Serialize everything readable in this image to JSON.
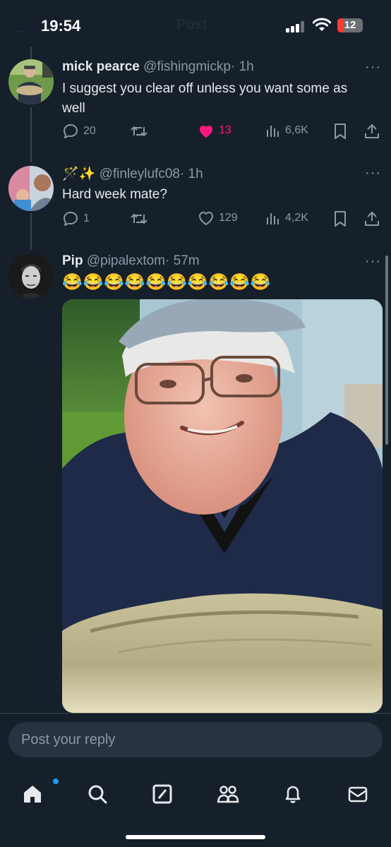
{
  "status_bar": {
    "time": "19:54",
    "battery": "12"
  },
  "header": {
    "back": "←",
    "title": "Post"
  },
  "tweets": [
    {
      "name": "mick pearce",
      "handle": "@fishingmickp",
      "time": "· 1h",
      "text": "I suggest you clear off unless you want some as well",
      "replies": "20",
      "likes": "13",
      "views": "6,6K",
      "liked": true
    },
    {
      "name": "🪄✨",
      "handle": "@finleylufc08",
      "time": "· 1h",
      "text": "Hard week mate?",
      "replies": "1",
      "likes": "129",
      "views": "4,2K",
      "liked": false
    },
    {
      "name": "Pip",
      "handle": "@pipalextom",
      "time": "· 57m",
      "text": "😂😂😂😂😂😂😂😂😂😂",
      "media": "photo-older-man-with-cap-holding-carp"
    }
  ],
  "reply": {
    "placeholder": "Post your reply"
  },
  "nav": [
    "home-icon",
    "search-icon",
    "grok-icon",
    "communities-icon",
    "notifications-icon",
    "messages-icon"
  ],
  "colors": {
    "background": "#15202b",
    "like": "#f91880",
    "accent": "#1d9bf0",
    "muted": "#8b98a5"
  }
}
